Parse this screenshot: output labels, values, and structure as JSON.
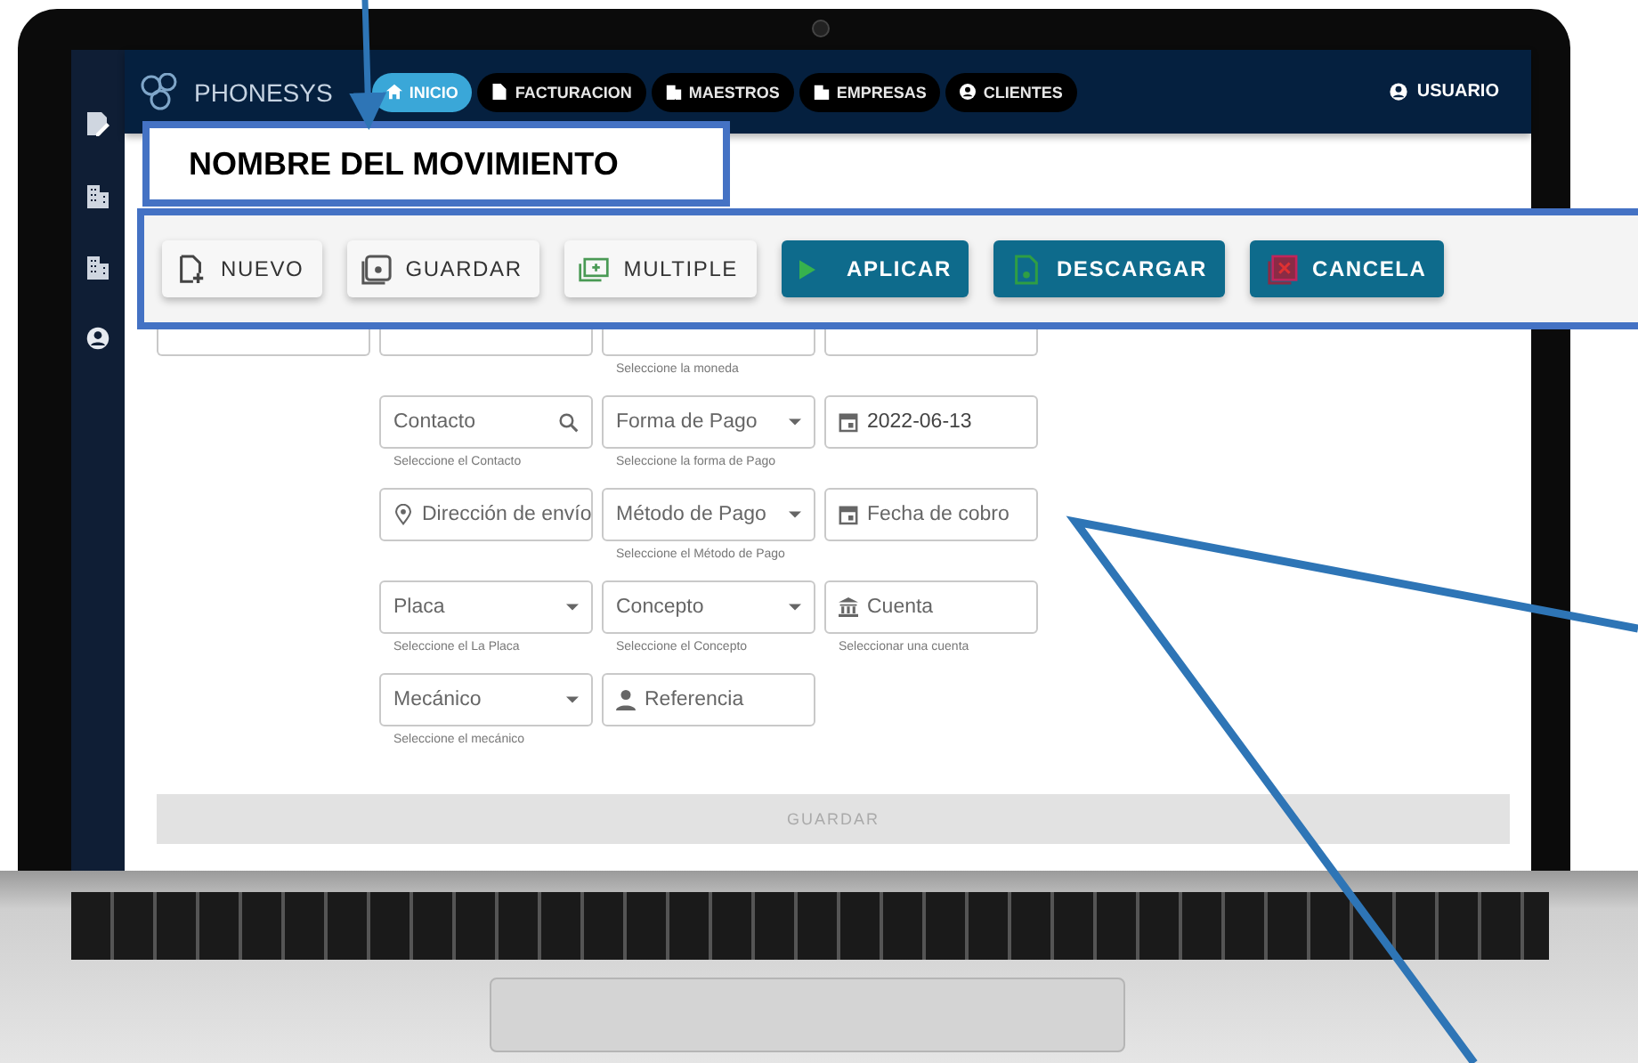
{
  "topbar": {
    "logo": "PHONESYS",
    "tabs": [
      {
        "label": "INICIO",
        "selected": true
      },
      {
        "label": "FACTURACION",
        "selected": false
      },
      {
        "label": "MAESTROS",
        "selected": false
      },
      {
        "label": "EMPRESAS",
        "selected": false
      },
      {
        "label": "CLIENTES",
        "selected": false
      }
    ],
    "user": "USUARIO"
  },
  "form": {
    "rows": [
      [
        {
          "kind": "covered"
        },
        {
          "kind": "covered"
        },
        {
          "kind": "covered",
          "hint": "Seleccione la moneda"
        },
        {
          "kind": "covered"
        }
      ],
      [
        null,
        {
          "kind": "search",
          "placeholder": "Contacto",
          "hint": "Seleccione el Contacto"
        },
        {
          "kind": "select",
          "placeholder": "Forma de Pago",
          "hint": "Seleccione la forma de Pago"
        },
        {
          "kind": "date",
          "value": "2022-06-13"
        }
      ],
      [
        null,
        {
          "kind": "location",
          "placeholder": "Dirección de envío"
        },
        {
          "kind": "select",
          "placeholder": "Método de Pago",
          "hint": "Seleccione el Método de Pago"
        },
        {
          "kind": "date",
          "placeholder": "Fecha de cobro"
        }
      ],
      [
        null,
        {
          "kind": "select",
          "placeholder": "Placa",
          "hint": "Seleccione el La Placa"
        },
        {
          "kind": "select",
          "placeholder": "Concepto",
          "hint": "Seleccione el Concepto"
        },
        {
          "kind": "bank",
          "placeholder": "Cuenta",
          "hint": "Seleccionar una cuenta"
        }
      ],
      [
        null,
        {
          "kind": "select",
          "placeholder": "Mecánico",
          "hint": "Seleccione el mecánico"
        },
        {
          "kind": "person",
          "placeholder": "Referencia"
        }
      ]
    ],
    "submit": {
      "label": "GUARDAR",
      "disabled": true
    }
  },
  "callout": {
    "label": "NOMBRE DEL MOVIMIENTO"
  },
  "toolbar": [
    {
      "label": "NUEVO",
      "kind": "light"
    },
    {
      "label": "GUARDAR",
      "kind": "light"
    },
    {
      "label": "MULTIPLE",
      "kind": "light"
    },
    {
      "label": "APLICAR",
      "kind": "primary"
    },
    {
      "label": "DESCARGAR",
      "kind": "primary"
    },
    {
      "label": "CANCELA",
      "kind": "primary"
    }
  ]
}
